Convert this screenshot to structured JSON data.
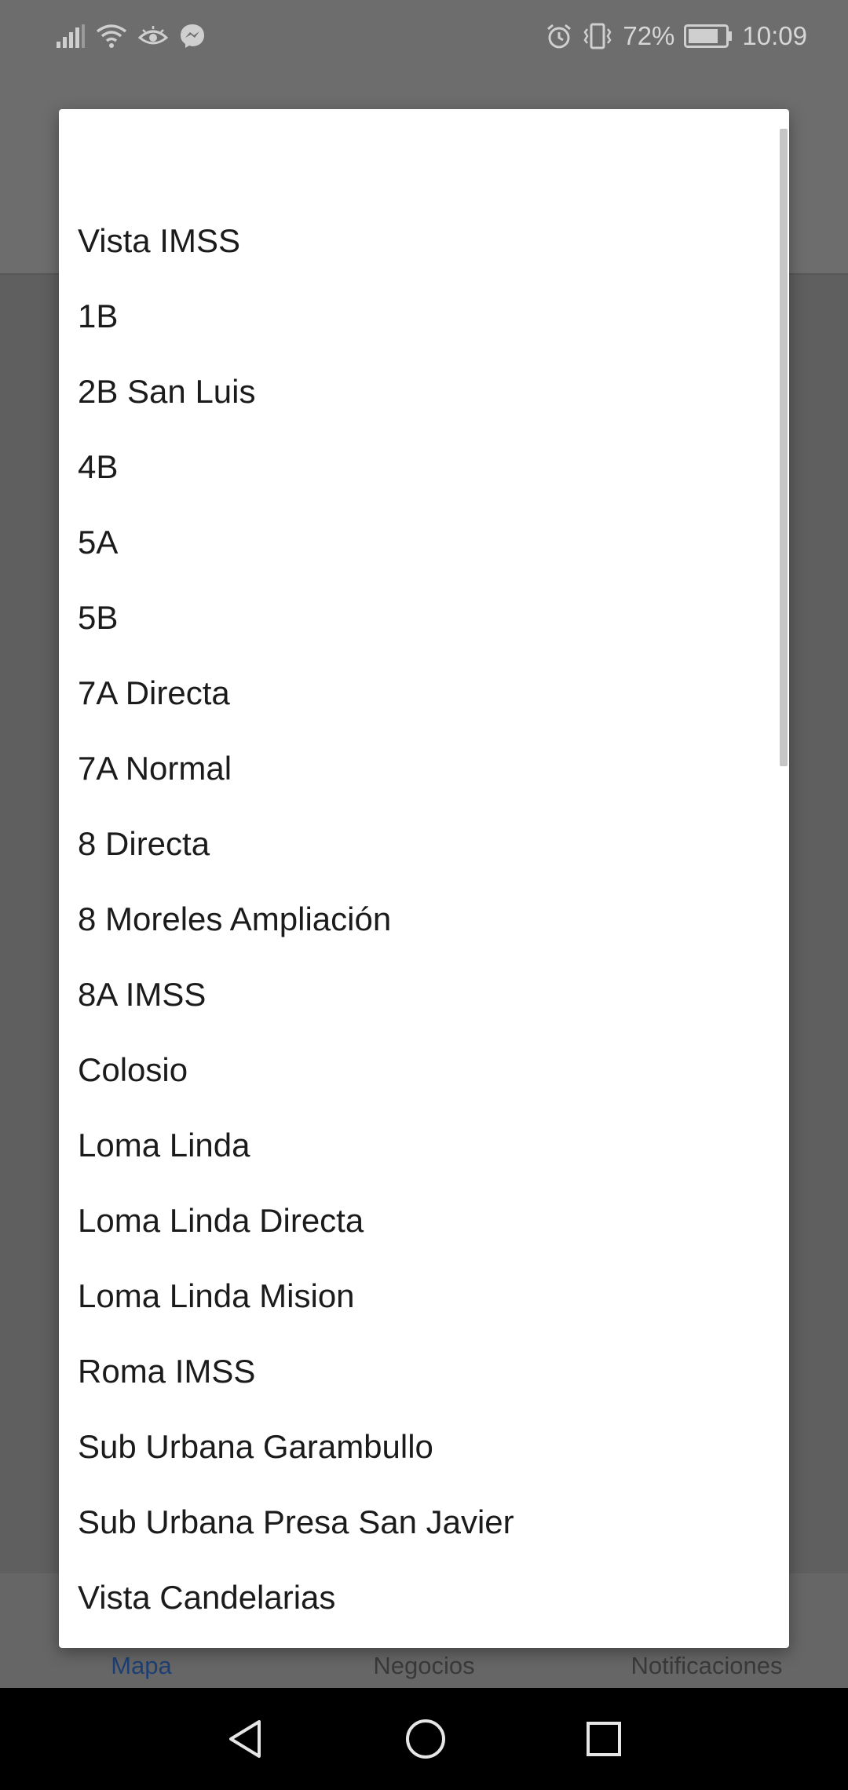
{
  "status_bar": {
    "battery": "72%",
    "time": "10:09",
    "icons_left": [
      "signal-icon",
      "wifi-icon",
      "eye-icon",
      "messenger-icon"
    ],
    "icons_right": [
      "alarm-icon",
      "vibrate-icon",
      "battery-icon"
    ]
  },
  "dialog": {
    "items": [
      "Vista IMSS",
      "1B",
      "2B San Luis",
      "4B",
      "5A",
      "5B",
      "7A Directa",
      "7A Normal",
      "8 Directa",
      "8 Moreles Ampliación",
      "8A IMSS",
      "Colosio",
      "Loma Linda",
      "Loma Linda Directa",
      "Loma Linda Mision",
      "Roma IMSS",
      "Sub Urbana Garambullo",
      "Sub Urbana Presa San Javier",
      "Vista Candelarias"
    ]
  },
  "bottom_nav": {
    "tabs": [
      {
        "label": "Mapa",
        "active": true
      },
      {
        "label": "Negocios",
        "active": false
      },
      {
        "label": "Notificaciones",
        "active": false
      }
    ]
  },
  "system_nav": [
    "back-icon",
    "home-icon",
    "recents-icon"
  ],
  "colors": {
    "scrim": "#6a6a6a",
    "dialog_bg": "#ffffff",
    "active_tab": "#1e3f73"
  }
}
